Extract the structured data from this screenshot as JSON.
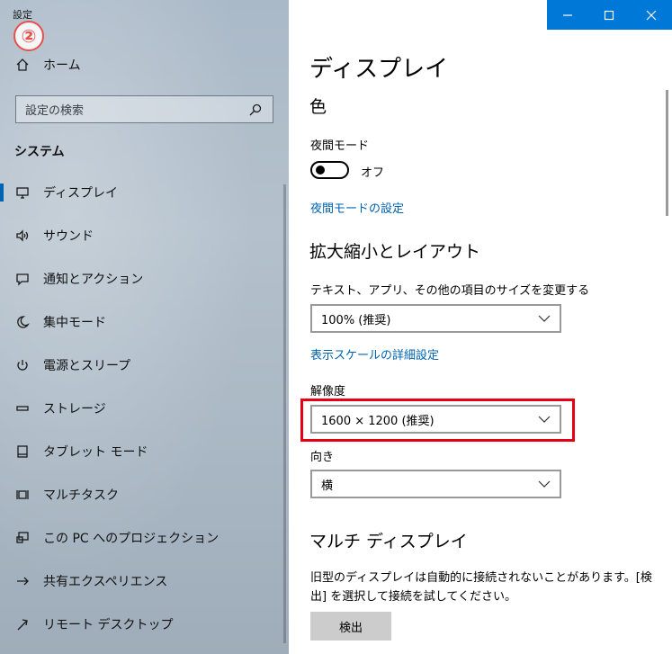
{
  "app_title": "設定",
  "step_badge": "②",
  "window_controls": {
    "minimize": "—",
    "maximize": "☐",
    "close": "✕"
  },
  "sidebar": {
    "home": {
      "label": "ホーム",
      "icon": "home-icon"
    },
    "search_placeholder": "設定の検索",
    "section": "システム",
    "items": [
      {
        "label": "ディスプレイ",
        "icon": "monitor-icon",
        "active": true
      },
      {
        "label": "サウンド",
        "icon": "speaker-icon"
      },
      {
        "label": "通知とアクション",
        "icon": "notification-icon"
      },
      {
        "label": "集中モード",
        "icon": "moon-icon"
      },
      {
        "label": "電源とスリープ",
        "icon": "power-icon"
      },
      {
        "label": "ストレージ",
        "icon": "storage-icon"
      },
      {
        "label": "タブレット モード",
        "icon": "tablet-icon"
      },
      {
        "label": "マルチタスク",
        "icon": "multitask-icon"
      },
      {
        "label": "この PC へのプロジェクション",
        "icon": "projection-icon"
      },
      {
        "label": "共有エクスペリエンス",
        "icon": "share-icon"
      },
      {
        "label": "リモート デスクトップ",
        "icon": "remote-desktop-icon"
      }
    ]
  },
  "main": {
    "title": "ディスプレイ",
    "color_heading": "色",
    "night_mode_label": "夜間モード",
    "night_mode_state": "オフ",
    "night_mode_link": "夜間モードの設定",
    "scale_heading": "拡大縮小とレイアウト",
    "scale_label": "テキスト、アプリ、その他の項目のサイズを変更する",
    "scale_value": "100% (推奨)",
    "scale_link": "表示スケールの詳細設定",
    "resolution_label": "解像度",
    "resolution_value": "1600 × 1200 (推奨)",
    "orientation_label": "向き",
    "orientation_value": "横",
    "multi_heading": "マルチ ディスプレイ",
    "multi_text": "旧型のディスプレイは自動的に接続されないことがあります。[検出] を選択して接続を試してください。",
    "detect_button": "検出"
  },
  "colors": {
    "accent": "#0078d7",
    "link": "#0063b1",
    "highlight": "#e50014",
    "badge": "#e8504a"
  }
}
